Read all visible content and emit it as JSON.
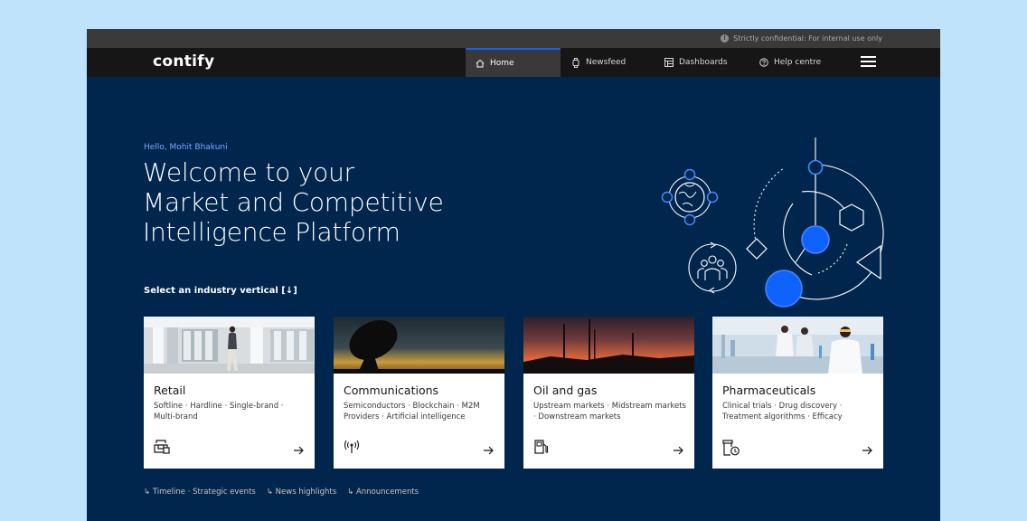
{
  "topbar": {
    "notice": "Strictly confidential: For internal use only"
  },
  "brand": {
    "logo": "contify"
  },
  "nav": {
    "items": [
      {
        "label": "Home",
        "icon": "home-icon",
        "active": true
      },
      {
        "label": "Newsfeed",
        "icon": "watch-icon",
        "active": false
      },
      {
        "label": "Dashboards",
        "icon": "dashboard-icon",
        "active": false
      },
      {
        "label": "Help centre",
        "icon": "help-icon",
        "active": false
      }
    ],
    "menu_icon": "hamburger-menu-icon"
  },
  "main": {
    "greeting": "Hello, Mohit Bhakuni",
    "headline": [
      "Welcome to your",
      "Market and Competitive",
      "Intelligence Platform"
    ],
    "select_label": "Select an industry vertical [↓]"
  },
  "cards": [
    {
      "title": "Retail",
      "desc": "Softline · Hardline · Single-brand · Multi-brand",
      "icon": "store-icon"
    },
    {
      "title": "Communications",
      "desc": "Semiconductors · Blockchain · M2M Providers · Artificial intelligence",
      "icon": "antenna-icon"
    },
    {
      "title": "Oil and gas",
      "desc": "Upstream markets · Midstream markets · Downstream markets",
      "icon": "fuel-pump-icon"
    },
    {
      "title": "Pharmaceuticals",
      "desc": "Clinical trials · Drug discovery · Treatment algorithms · Efficacy",
      "icon": "medicine-bottle-icon"
    }
  ],
  "quick_links": [
    "↳ Timeline · Strategic events",
    "↳ News highlights",
    "↳ Announcements"
  ],
  "colors": {
    "background": "#00264d",
    "accent": "#0f62fe",
    "link": "#78a9ff"
  }
}
